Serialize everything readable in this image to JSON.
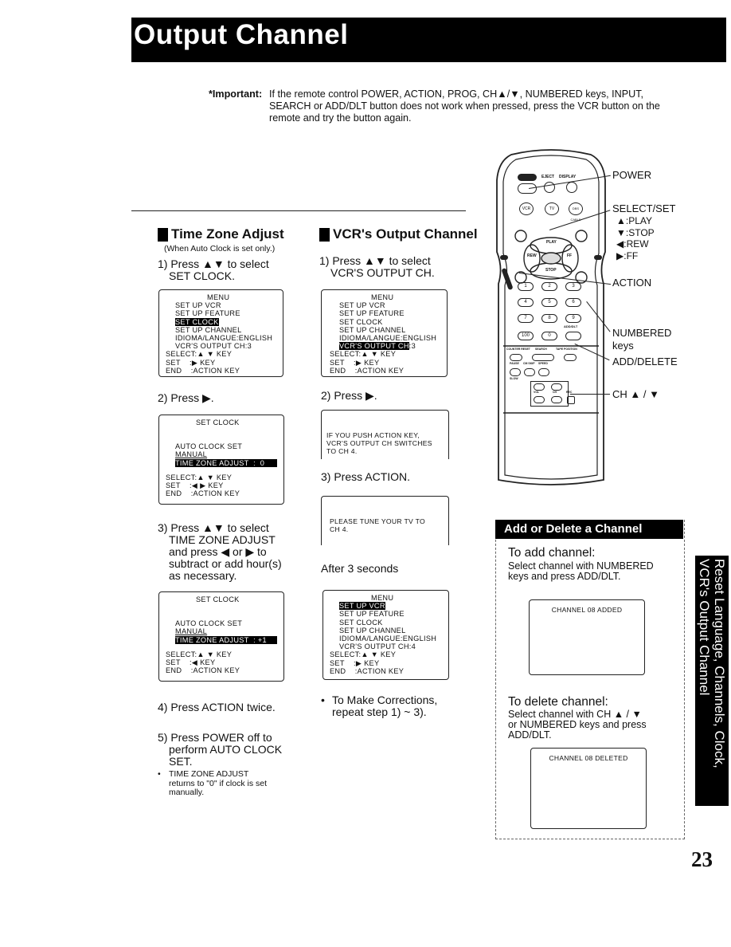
{
  "header": {
    "title": "Output Channel"
  },
  "important": {
    "label": "*Important:",
    "text": "If the remote control POWER, ACTION, PROG, CH▲/▼, NUMBERED keys, INPUT, SEARCH or ADD/DLT button does not work when pressed, press the VCR button on the remote and try the button again."
  },
  "time_zone": {
    "title": "Time Zone Adjust",
    "note": "(When Auto Clock is set only.)",
    "step1": {
      "line1": "1) Press ▲▼ to select",
      "line2": "SET CLOCK."
    },
    "screen1": {
      "rows": [
        {
          "text": "MENU",
          "center": true
        },
        {
          "text": "SET UP VCR",
          "indent": 2
        },
        {
          "text": "SET UP FEATURE",
          "indent": 2
        },
        {
          "text": "SET CLOCK",
          "indent": 2,
          "highlight": true
        },
        {
          "text": "SET UP CHANNEL",
          "indent": 2
        },
        {
          "text": "IDIOMA/LANGUE:ENGLISH",
          "indent": 2
        },
        {
          "text": "VCR'S OUTPUT CH:3",
          "indent": 2
        },
        {
          "text": "SELECT:▲ ▼ KEY",
          "indent": 0
        },
        {
          "text": "SET    :▶ KEY",
          "indent": 0
        },
        {
          "text": "END    :ACTION KEY",
          "indent": 0
        }
      ]
    },
    "step2": "2) Press ▶.",
    "screen2": {
      "title": "SET CLOCK",
      "line_auto": "AUTO CLOCK SET",
      "line_manual": "MANUAL",
      "line_tz": "TIME ZONE ADJUST  :  0",
      "select": "SELECT:▲ ▼ KEY",
      "set": "SET    :◀ ▶ KEY",
      "end": "END    :ACTION KEY"
    },
    "step3": {
      "line1": "3) Press ▲▼ to select",
      "line2": "TIME ZONE ADJUST",
      "line3": "and press ◀ or ▶ to",
      "line4": "subtract or add hour(s)",
      "line5": "as necessary."
    },
    "screen3": {
      "title": "SET CLOCK",
      "line_auto": "AUTO CLOCK SET",
      "line_manual": "MANUAL",
      "line_tz": "TIME ZONE ADJUST  : +1",
      "select": "SELECT:▲ ▼ KEY",
      "set": "SET    :◀ KEY",
      "end": "END    :ACTION KEY"
    },
    "step4": "4) Press ACTION twice.",
    "step5": {
      "line1": "5) Press POWER off to",
      "line2": "perform AUTO CLOCK",
      "line3": "SET."
    },
    "bullet": {
      "line1": "TIME ZONE ADJUST",
      "line2": "returns to \"0\" if clock is set",
      "line3": "manually."
    }
  },
  "output_channel": {
    "title": "VCR's Output Channel",
    "step1": {
      "line1": "1) Press ▲▼ to select",
      "line2": "VCR'S OUTPUT CH."
    },
    "screen1": {
      "rows": [
        {
          "text": "MENU",
          "center": true
        },
        {
          "text": "SET UP VCR",
          "indent": 2
        },
        {
          "text": "SET UP FEATURE",
          "indent": 2
        },
        {
          "text": "SET CLOCK",
          "indent": 2
        },
        {
          "text": "SET UP CHANNEL",
          "indent": 2
        },
        {
          "text": "IDIOMA/LANGUE:ENGLISH",
          "indent": 2
        },
        {
          "text": "VCR'S OUTPUT CH",
          "indent": 2,
          "highlight": true,
          "suffix": ":3"
        },
        {
          "text": "SELECT:▲ ▼ KEY",
          "indent": 0
        },
        {
          "text": "SET    :▶ KEY",
          "indent": 0
        },
        {
          "text": "END    :ACTION KEY",
          "indent": 0
        }
      ]
    },
    "step2": "2) Press ▶.",
    "screen2": {
      "line1": "IF YOU PUSH ACTION KEY,",
      "line2": "VCR'S OUTPUT CH SWITCHES",
      "line3": "TO CH 4."
    },
    "step3": "3) Press ACTION.",
    "screen3": {
      "line1": "PLEASE TUNE YOUR TV TO",
      "line2": "CH 4."
    },
    "after": "After 3 seconds",
    "screen4": {
      "rows": [
        {
          "text": "MENU",
          "center": true
        },
        {
          "text": "SET UP VCR",
          "indent": 2,
          "highlight": true
        },
        {
          "text": "SET UP FEATURE",
          "indent": 2
        },
        {
          "text": "SET CLOCK",
          "indent": 2
        },
        {
          "text": "SET UP CHANNEL",
          "indent": 2
        },
        {
          "text": "IDIOMA/LANGUE:ENGLISH",
          "indent": 2
        },
        {
          "text": "VCR'S OUTPUT CH:4",
          "indent": 2
        },
        {
          "text": "SELECT:▲ ▼ KEY",
          "indent": 0
        },
        {
          "text": "SET    :▶ KEY",
          "indent": 0
        },
        {
          "text": "END    :ACTION KEY",
          "indent": 0
        }
      ]
    },
    "bullet": {
      "line1": "To Make Corrections,",
      "line2": "repeat step 1) ~ 3)."
    }
  },
  "remote": {
    "labels": {
      "power": "POWER",
      "select_set": "SELECT/SET",
      "play": "▲:PLAY",
      "stop": "▼:STOP",
      "rew": "◀:REW",
      "ff": "▶:FF",
      "action": "ACTION",
      "numbered1": "NUMBERED",
      "numbered2": "keys",
      "add_delete": "ADD/DELETE",
      "ch": "CH ▲ / ▼"
    },
    "buttons": {
      "power": "POWER",
      "eject": "EJECT",
      "display": "DISPLAY",
      "vcr": "VCR",
      "tv": "TV",
      "dbs": "DBS CABLE",
      "play": "PLAY",
      "stop": "STOP",
      "rew": "REW",
      "ff": "FF",
      "select": "SELECT",
      "n1": "1",
      "n2": "2",
      "n3": "3",
      "n4": "4",
      "n5": "5",
      "n6": "6",
      "n7": "7",
      "n8": "8",
      "n9": "9",
      "n100": "100",
      "n0": "0",
      "adddlt": "ADD/DLT",
      "counter": "COUNTER RESET",
      "search": "SEARCH",
      "tape": "TAPE POSITION",
      "pause": "PAUSE",
      "slow": "SLOW",
      "cmskip": "CM SKIP",
      "speed": "SPEED",
      "vol": "VOL",
      "ch": "CH",
      "rec": "REC"
    }
  },
  "add_delete": {
    "title": "Add or Delete a Channel",
    "add_head": "To add channel:",
    "add_text1": "Select channel with NUMBERED",
    "add_text2": "keys and press ADD/DLT.",
    "add_screen": "CHANNEL 08 ADDED",
    "del_head": "To delete channel:",
    "del_text1": "Select channel with CH ▲ / ▼",
    "del_text2": "or NUMBERED keys and press",
    "del_text3": "ADD/DLT.",
    "del_screen": "CHANNEL 08 DELETED"
  },
  "side_tab": {
    "line1": "Reset Language, Channels, Clock,",
    "line2": "VCR's Output Channel"
  },
  "page_number": "23"
}
